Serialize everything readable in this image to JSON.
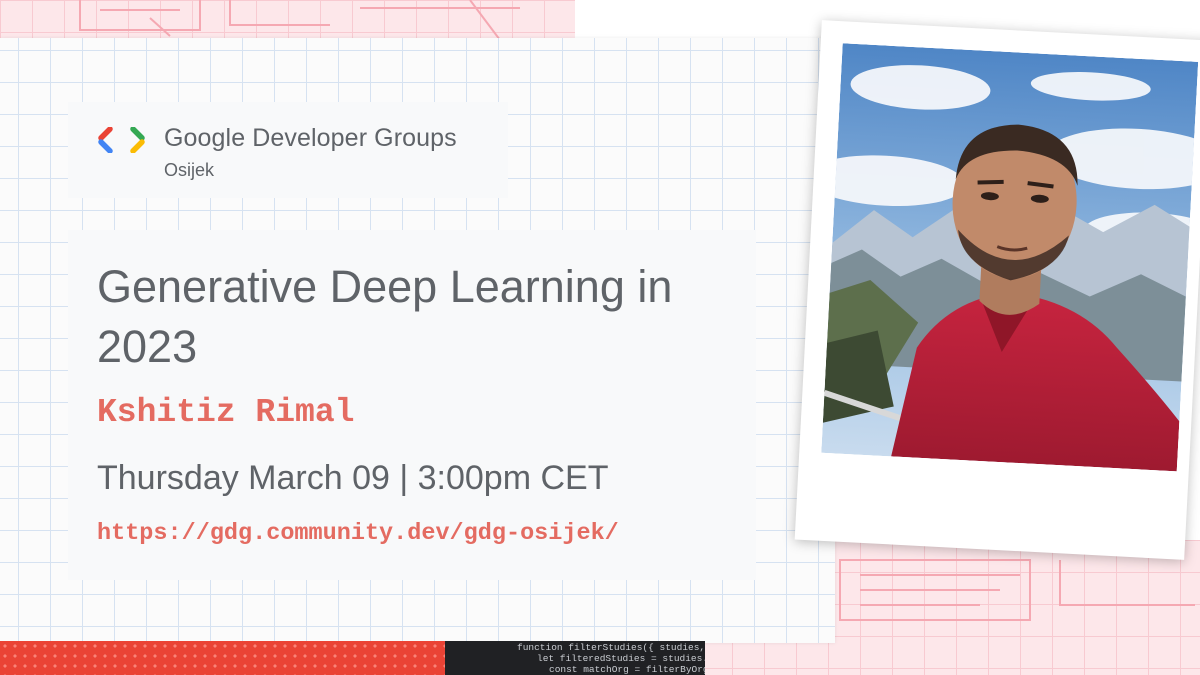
{
  "brand": {
    "name": "Google Developer Groups",
    "chapter": "Osijek",
    "colors": {
      "blue": "#4285f4",
      "red": "#ea4335",
      "green": "#34a853",
      "yellow": "#fbbc04"
    }
  },
  "event": {
    "title": "Generative Deep Learning in 2023",
    "speaker": "Kshitiz Rimal",
    "datetime": "Thursday March 09 | 3:00pm CET",
    "link": "https://gdg.community.dev/gdg-osijek/"
  },
  "decor": {
    "code_lines": [
      "function filterStudies({ studies, f",
      "let filteredStudies = studies.f",
      "const matchOrg = filterByOrg"
    ],
    "accent_text": "#e46b61",
    "body_text": "#5f6368"
  },
  "photo": {
    "icon": "speaker-portrait-photo"
  }
}
